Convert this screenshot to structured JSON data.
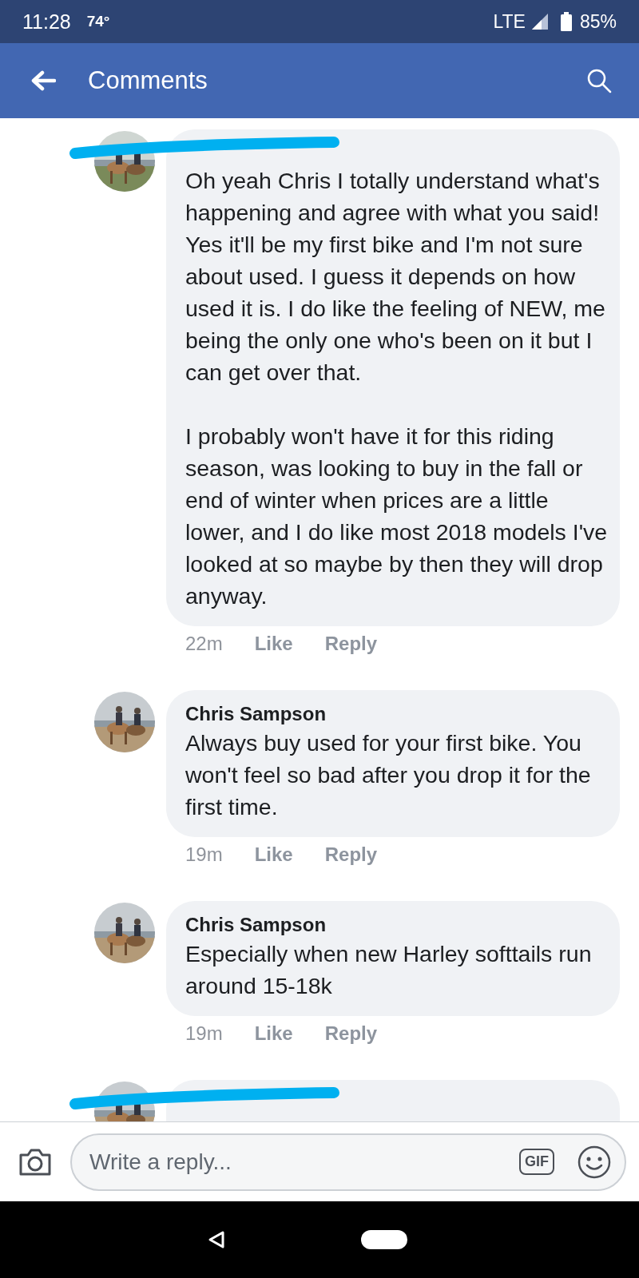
{
  "status_bar": {
    "time": "11:28",
    "temperature": "74°",
    "network": "LTE",
    "battery": "85%"
  },
  "app_bar": {
    "title": "Comments"
  },
  "comments": [
    {
      "paragraphs": [
        "Oh yeah Chris I totally understand what's happening and agree with what you said! Yes it'll be my first bike and I'm not sure about used. I guess it depends on how used it is. I do like the feeling of NEW, me being the only one who's been on it but I can get over that.",
        "I probably won't have it for this riding season, was looking to buy in the fall or end of winter when prices are a little lower, and I do like most 2018 models I've looked at so maybe by then they will drop anyway."
      ],
      "time": "22m",
      "like": "Like",
      "reply": "Reply",
      "redacted": true
    },
    {
      "author": "Chris Sampson",
      "paragraphs": [
        "Always buy used for your first bike. You won't feel so bad after you drop it for the first time."
      ],
      "time": "19m",
      "like": "Like",
      "reply": "Reply",
      "redacted": false
    },
    {
      "author": "Chris Sampson",
      "paragraphs": [
        "Especially when new Harley softtails run around 15-18k"
      ],
      "time": "19m",
      "like": "Like",
      "reply": "Reply",
      "redacted": false
    },
    {
      "redacted": true
    }
  ],
  "composer": {
    "placeholder": "Write a reply...",
    "gif_label": "GIF"
  }
}
